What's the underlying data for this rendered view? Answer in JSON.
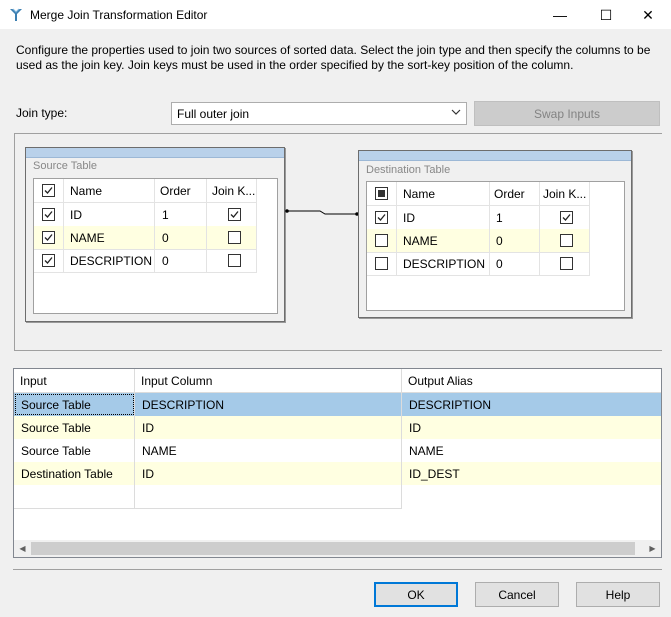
{
  "window": {
    "title": "Merge Join Transformation Editor",
    "minimize_glyph": "—",
    "maximize_glyph": "☐",
    "close_glyph": "✕"
  },
  "description": "Configure the properties used to join two sources of sorted data. Select the join type and then specify the columns to be used as the join key. Join keys must be used in the order specified by the sort-key position of the column.",
  "join": {
    "label": "Join type:",
    "selected": "Full outer join",
    "swap_label": "Swap Inputs"
  },
  "source_table": {
    "name": "Source Table",
    "columns": [
      "Name",
      "Order",
      "Join K..."
    ],
    "header_checked": "checked",
    "rows": [
      {
        "checked": true,
        "name": "ID",
        "order": "1",
        "join_key": true
      },
      {
        "checked": true,
        "name": "NAME",
        "order": "0",
        "join_key": false
      },
      {
        "checked": true,
        "name": "DESCRIPTION",
        "order": "0",
        "join_key": false
      }
    ]
  },
  "destination_table": {
    "name": "Destination Table",
    "columns": [
      "Name",
      "Order",
      "Join K..."
    ],
    "header_checked": "indeterminate",
    "rows": [
      {
        "checked": true,
        "name": "ID",
        "order": "1",
        "join_key": true
      },
      {
        "checked": false,
        "name": "NAME",
        "order": "0",
        "join_key": false
      },
      {
        "checked": false,
        "name": "DESCRIPTION",
        "order": "0",
        "join_key": false
      }
    ]
  },
  "mapping": {
    "headers": [
      "Input",
      "Input Column",
      "Output Alias"
    ],
    "rows": [
      {
        "input": "Source Table",
        "input_column": "DESCRIPTION",
        "output_alias": "DESCRIPTION"
      },
      {
        "input": "Source Table",
        "input_column": "ID",
        "output_alias": "ID"
      },
      {
        "input": "Source Table",
        "input_column": "NAME",
        "output_alias": "NAME"
      },
      {
        "input": "Destination Table",
        "input_column": "ID",
        "output_alias": "ID_DEST"
      },
      {
        "input": "",
        "input_column": "",
        "output_alias": ""
      }
    ]
  },
  "buttons": {
    "ok": "OK",
    "cancel": "Cancel",
    "help": "Help"
  },
  "colors": {
    "selected_row": "#a5cae8",
    "alt_row": "#ffffe1",
    "table_header": "#b9d1ea",
    "default_button_border": "#0078d7"
  }
}
